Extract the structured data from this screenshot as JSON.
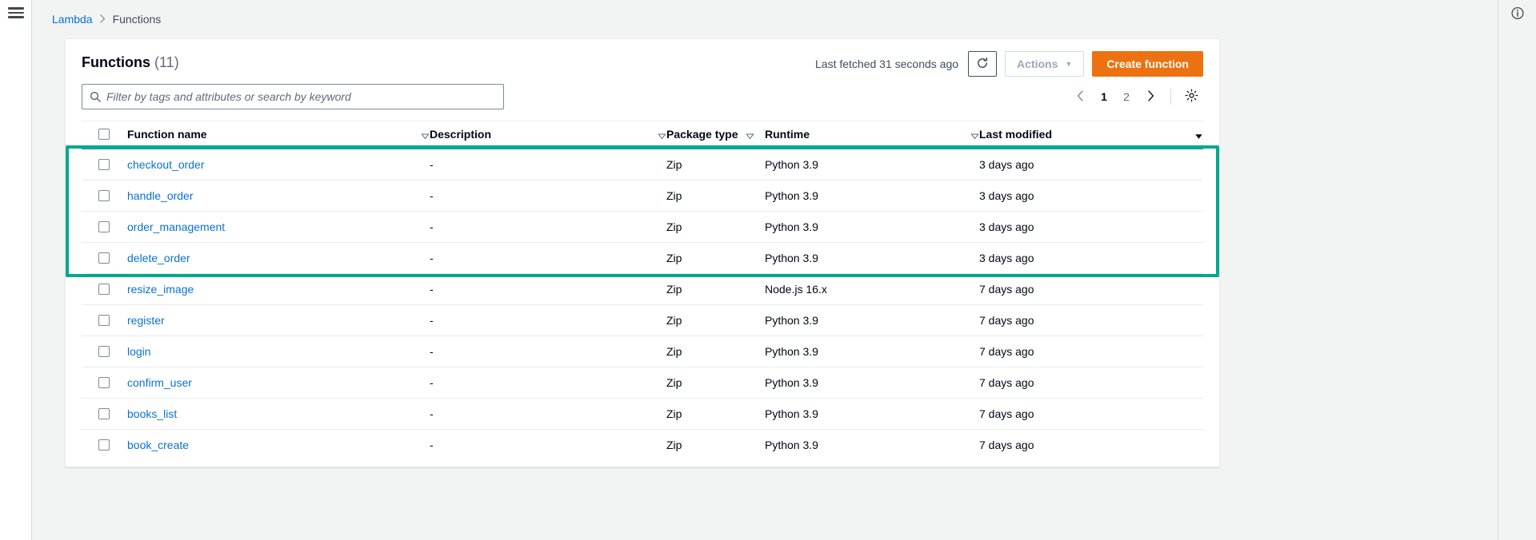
{
  "nav": {
    "menu_icon": "hamburger-icon",
    "info_icon": "info-circle-icon"
  },
  "breadcrumb": {
    "root": "Lambda",
    "separator": "›",
    "current": "Functions"
  },
  "panel": {
    "title": "Functions",
    "count": "(11)",
    "last_fetched": "Last fetched 31 seconds ago",
    "refresh_icon": "refresh-icon",
    "actions_label": "Actions",
    "actions_caret": "▼",
    "create_label": "Create function",
    "create_color": "#ec7211"
  },
  "search": {
    "placeholder": "Filter by tags and attributes or search by keyword",
    "value": "",
    "icon": "search-icon"
  },
  "pagination": {
    "prev_icon": "chevron-left-icon",
    "next_icon": "chevron-right-icon",
    "pages": [
      "1",
      "2"
    ],
    "current": "1",
    "settings_icon": "gear-icon"
  },
  "table": {
    "columns": [
      {
        "key": "name",
        "label": "Function name",
        "sortable": true,
        "sorted": false
      },
      {
        "key": "description",
        "label": "Description",
        "sortable": true,
        "sorted": false
      },
      {
        "key": "package_type",
        "label": "Package type",
        "sortable": true,
        "sorted": false
      },
      {
        "key": "runtime",
        "label": "Runtime",
        "sortable": true,
        "sorted": false
      },
      {
        "key": "last_modified",
        "label": "Last modified",
        "sortable": true,
        "sorted": true,
        "direction": "desc"
      }
    ],
    "rows": [
      {
        "name": "checkout_order",
        "description": "-",
        "package_type": "Zip",
        "runtime": "Python 3.9",
        "last_modified": "3 days ago",
        "highlighted": true
      },
      {
        "name": "handle_order",
        "description": "-",
        "package_type": "Zip",
        "runtime": "Python 3.9",
        "last_modified": "3 days ago",
        "highlighted": true
      },
      {
        "name": "order_management",
        "description": "-",
        "package_type": "Zip",
        "runtime": "Python 3.9",
        "last_modified": "3 days ago",
        "highlighted": true
      },
      {
        "name": "delete_order",
        "description": "-",
        "package_type": "Zip",
        "runtime": "Python 3.9",
        "last_modified": "3 days ago",
        "highlighted": true
      },
      {
        "name": "resize_image",
        "description": "-",
        "package_type": "Zip",
        "runtime": "Node.js 16.x",
        "last_modified": "7 days ago",
        "highlighted": false
      },
      {
        "name": "register",
        "description": "-",
        "package_type": "Zip",
        "runtime": "Python 3.9",
        "last_modified": "7 days ago",
        "highlighted": false
      },
      {
        "name": "login",
        "description": "-",
        "package_type": "Zip",
        "runtime": "Python 3.9",
        "last_modified": "7 days ago",
        "highlighted": false
      },
      {
        "name": "confirm_user",
        "description": "-",
        "package_type": "Zip",
        "runtime": "Python 3.9",
        "last_modified": "7 days ago",
        "highlighted": false
      },
      {
        "name": "books_list",
        "description": "-",
        "package_type": "Zip",
        "runtime": "Python 3.9",
        "last_modified": "7 days ago",
        "highlighted": false
      },
      {
        "name": "book_create",
        "description": "-",
        "package_type": "Zip",
        "runtime": "Python 3.9",
        "last_modified": "7 days ago",
        "highlighted": false
      }
    ]
  },
  "highlight": {
    "color": "#00a88e",
    "rows": 4
  }
}
